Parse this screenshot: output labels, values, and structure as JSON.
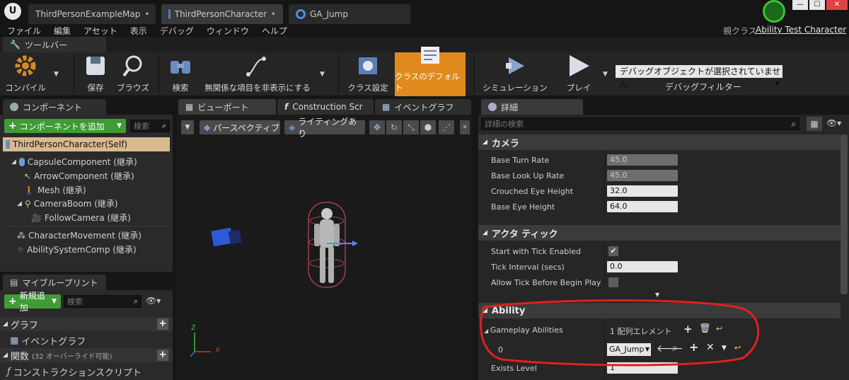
{
  "titlebar": {
    "tabs": [
      "ThirdPersonExampleMap",
      "ThirdPersonCharacter",
      "GA_Jump"
    ],
    "parent_class_label": "親クラス",
    "parent_class_value": "Ability Test Character"
  },
  "menu": [
    "ファイル",
    "編集",
    "アセット",
    "表示",
    "デバッグ",
    "ウィンドウ",
    "ヘルプ"
  ],
  "toolbar": {
    "tab_label": "ツールバー",
    "buttons": [
      "コンパイル",
      "保存",
      "ブラウズ",
      "検索",
      "無関係な項目を非表示にする",
      "クラス設定",
      "クラスのデフォルト",
      "シミュレーション",
      "プレイ"
    ],
    "debug_select": "デバッグオブジェクトが選択されていません",
    "debug_filter": "デバッグフィルター"
  },
  "components": {
    "tab_label": "コンポーネント",
    "add_button": "コンポーネントを追加",
    "search_placeholder": "検索",
    "root": "ThirdPersonCharacter(Self)",
    "items": [
      "CapsuleComponent (継承)",
      "ArrowComponent (継承)",
      "Mesh (継承)",
      "CameraBoom (継承)",
      "FollowCamera (継承)",
      "CharacterMovement (継承)",
      "AbilitySystemComp (継承)"
    ]
  },
  "myblueprint": {
    "tab_label": "マイブループリント",
    "add_new": "新規追加",
    "search_placeholder": "検索",
    "graph_section": "グラフ",
    "event_graph": "イベントグラフ",
    "functions_section": "関数",
    "functions_note": "(32 オーバーライド可能)",
    "construction_script": "コンストラクションスクリプト"
  },
  "viewport": {
    "tabs": [
      "ビューポート",
      "Construction Scr",
      "イベントグラフ"
    ],
    "perspective": "パースペクティブ",
    "lighting": "ライティングあり",
    "axis_x": "X",
    "axis_z": "Z"
  },
  "details": {
    "tab_label": "詳細",
    "search_placeholder": "詳細の検索",
    "camera_section": "カメラ",
    "camera_props": [
      {
        "label": "Base Turn Rate",
        "value": "45.0"
      },
      {
        "label": "Base Look Up Rate",
        "value": "45.0"
      },
      {
        "label": "Crouched Eye Height",
        "value": "32.0"
      },
      {
        "label": "Base Eye Height",
        "value": "64.0"
      }
    ],
    "actor_tick_section": "アクタ ティック",
    "tick_props": [
      {
        "label": "Start with Tick Enabled",
        "value": "✔"
      },
      {
        "label": "Tick Interval (secs)",
        "value": "0.0"
      },
      {
        "label": "Allow Tick Before Begin Play",
        "value": ""
      }
    ],
    "ability_section": "Ability",
    "gameplay_abilities_label": "Gameplay Abilities",
    "array_count": "1 配列エレメント",
    "element_index": "0",
    "element_value": "GA_Jump",
    "exists_level_label": "Exists Level",
    "exists_level_value": "1"
  },
  "colors": {
    "accent_orange": "#e08a1e",
    "green": "#3f9b36",
    "annotation_red": "#e02020"
  }
}
